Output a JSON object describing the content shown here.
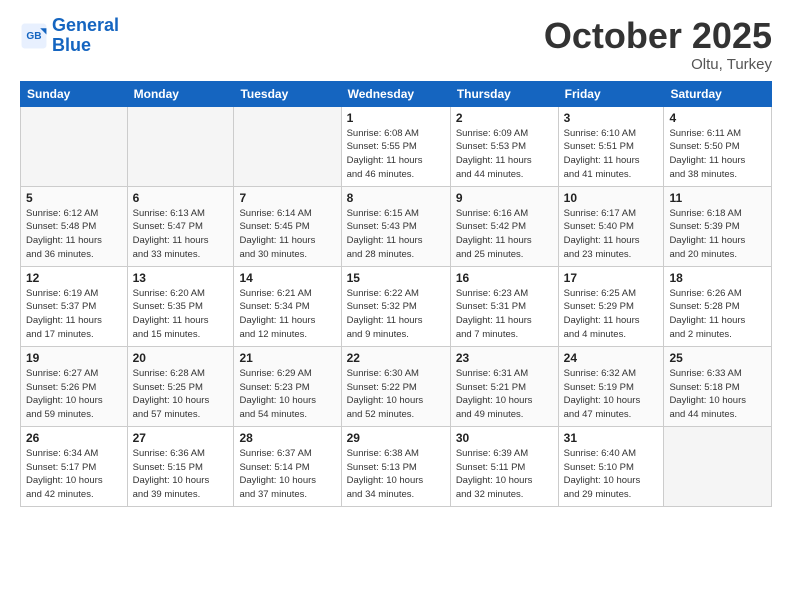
{
  "logo": {
    "line1": "General",
    "line2": "Blue"
  },
  "header": {
    "month": "October 2025",
    "location": "Oltu, Turkey"
  },
  "days_of_week": [
    "Sunday",
    "Monday",
    "Tuesday",
    "Wednesday",
    "Thursday",
    "Friday",
    "Saturday"
  ],
  "weeks": [
    [
      {
        "num": "",
        "info": ""
      },
      {
        "num": "",
        "info": ""
      },
      {
        "num": "",
        "info": ""
      },
      {
        "num": "1",
        "info": "Sunrise: 6:08 AM\nSunset: 5:55 PM\nDaylight: 11 hours\nand 46 minutes."
      },
      {
        "num": "2",
        "info": "Sunrise: 6:09 AM\nSunset: 5:53 PM\nDaylight: 11 hours\nand 44 minutes."
      },
      {
        "num": "3",
        "info": "Sunrise: 6:10 AM\nSunset: 5:51 PM\nDaylight: 11 hours\nand 41 minutes."
      },
      {
        "num": "4",
        "info": "Sunrise: 6:11 AM\nSunset: 5:50 PM\nDaylight: 11 hours\nand 38 minutes."
      }
    ],
    [
      {
        "num": "5",
        "info": "Sunrise: 6:12 AM\nSunset: 5:48 PM\nDaylight: 11 hours\nand 36 minutes."
      },
      {
        "num": "6",
        "info": "Sunrise: 6:13 AM\nSunset: 5:47 PM\nDaylight: 11 hours\nand 33 minutes."
      },
      {
        "num": "7",
        "info": "Sunrise: 6:14 AM\nSunset: 5:45 PM\nDaylight: 11 hours\nand 30 minutes."
      },
      {
        "num": "8",
        "info": "Sunrise: 6:15 AM\nSunset: 5:43 PM\nDaylight: 11 hours\nand 28 minutes."
      },
      {
        "num": "9",
        "info": "Sunrise: 6:16 AM\nSunset: 5:42 PM\nDaylight: 11 hours\nand 25 minutes."
      },
      {
        "num": "10",
        "info": "Sunrise: 6:17 AM\nSunset: 5:40 PM\nDaylight: 11 hours\nand 23 minutes."
      },
      {
        "num": "11",
        "info": "Sunrise: 6:18 AM\nSunset: 5:39 PM\nDaylight: 11 hours\nand 20 minutes."
      }
    ],
    [
      {
        "num": "12",
        "info": "Sunrise: 6:19 AM\nSunset: 5:37 PM\nDaylight: 11 hours\nand 17 minutes."
      },
      {
        "num": "13",
        "info": "Sunrise: 6:20 AM\nSunset: 5:35 PM\nDaylight: 11 hours\nand 15 minutes."
      },
      {
        "num": "14",
        "info": "Sunrise: 6:21 AM\nSunset: 5:34 PM\nDaylight: 11 hours\nand 12 minutes."
      },
      {
        "num": "15",
        "info": "Sunrise: 6:22 AM\nSunset: 5:32 PM\nDaylight: 11 hours\nand 9 minutes."
      },
      {
        "num": "16",
        "info": "Sunrise: 6:23 AM\nSunset: 5:31 PM\nDaylight: 11 hours\nand 7 minutes."
      },
      {
        "num": "17",
        "info": "Sunrise: 6:25 AM\nSunset: 5:29 PM\nDaylight: 11 hours\nand 4 minutes."
      },
      {
        "num": "18",
        "info": "Sunrise: 6:26 AM\nSunset: 5:28 PM\nDaylight: 11 hours\nand 2 minutes."
      }
    ],
    [
      {
        "num": "19",
        "info": "Sunrise: 6:27 AM\nSunset: 5:26 PM\nDaylight: 10 hours\nand 59 minutes."
      },
      {
        "num": "20",
        "info": "Sunrise: 6:28 AM\nSunset: 5:25 PM\nDaylight: 10 hours\nand 57 minutes."
      },
      {
        "num": "21",
        "info": "Sunrise: 6:29 AM\nSunset: 5:23 PM\nDaylight: 10 hours\nand 54 minutes."
      },
      {
        "num": "22",
        "info": "Sunrise: 6:30 AM\nSunset: 5:22 PM\nDaylight: 10 hours\nand 52 minutes."
      },
      {
        "num": "23",
        "info": "Sunrise: 6:31 AM\nSunset: 5:21 PM\nDaylight: 10 hours\nand 49 minutes."
      },
      {
        "num": "24",
        "info": "Sunrise: 6:32 AM\nSunset: 5:19 PM\nDaylight: 10 hours\nand 47 minutes."
      },
      {
        "num": "25",
        "info": "Sunrise: 6:33 AM\nSunset: 5:18 PM\nDaylight: 10 hours\nand 44 minutes."
      }
    ],
    [
      {
        "num": "26",
        "info": "Sunrise: 6:34 AM\nSunset: 5:17 PM\nDaylight: 10 hours\nand 42 minutes."
      },
      {
        "num": "27",
        "info": "Sunrise: 6:36 AM\nSunset: 5:15 PM\nDaylight: 10 hours\nand 39 minutes."
      },
      {
        "num": "28",
        "info": "Sunrise: 6:37 AM\nSunset: 5:14 PM\nDaylight: 10 hours\nand 37 minutes."
      },
      {
        "num": "29",
        "info": "Sunrise: 6:38 AM\nSunset: 5:13 PM\nDaylight: 10 hours\nand 34 minutes."
      },
      {
        "num": "30",
        "info": "Sunrise: 6:39 AM\nSunset: 5:11 PM\nDaylight: 10 hours\nand 32 minutes."
      },
      {
        "num": "31",
        "info": "Sunrise: 6:40 AM\nSunset: 5:10 PM\nDaylight: 10 hours\nand 29 minutes."
      },
      {
        "num": "",
        "info": ""
      }
    ]
  ]
}
